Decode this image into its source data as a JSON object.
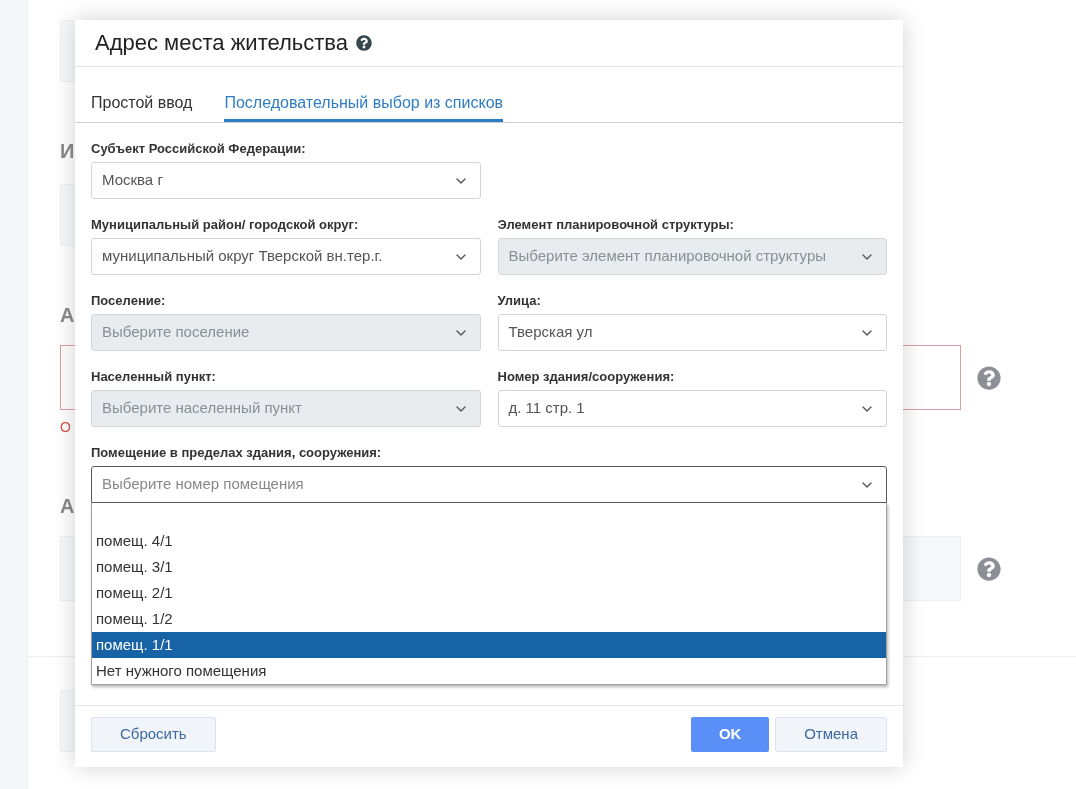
{
  "background": {
    "blocks": [
      {
        "kind": "panel"
      },
      {
        "kind": "heading",
        "text": "И"
      },
      {
        "kind": "panel"
      },
      {
        "kind": "heading",
        "text": "А"
      },
      {
        "kind": "field",
        "invalid": true
      },
      {
        "kind": "error",
        "text": "О"
      },
      {
        "kind": "heading",
        "text": "А"
      },
      {
        "kind": "field",
        "invalid": false
      },
      {
        "kind": "divider"
      },
      {
        "kind": "panel"
      }
    ]
  },
  "dialog": {
    "title": "Адрес места жительства",
    "tabs": [
      {
        "label": "Простой ввод",
        "selected": false
      },
      {
        "label": "Последовательный выбор из списков",
        "selected": true
      }
    ],
    "form": {
      "rows": [
        [
          {
            "label": "Субъект Российской Федерации:",
            "value": "Москва г",
            "disabled": false
          }
        ],
        [
          {
            "label": "Муниципальный район/ городской округ:",
            "value": "муниципальный округ Тверской вн.тер.г.",
            "disabled": false
          },
          {
            "label": "Элемент планировочной структуры:",
            "placeholder": "Выберите элемент планировочной структуры",
            "disabled": true
          }
        ],
        [
          {
            "label": "Поселение:",
            "placeholder": "Выберите поселение",
            "disabled": true
          },
          {
            "label": "Улица:",
            "value": "Тверская ул",
            "disabled": false
          }
        ],
        [
          {
            "label": "Населенный пункт:",
            "placeholder": "Выберите населенный пункт",
            "disabled": true
          },
          {
            "label": "Номер здания/сооружения:",
            "value": "д. 11 стр. 1",
            "disabled": false
          }
        ]
      ],
      "room": {
        "label": "Помещение в пределах здания, сооружения:",
        "placeholder": "Выберите номер помещения",
        "expanded": true,
        "options": [
          {
            "label": "помещ. 4/1",
            "selected": false
          },
          {
            "label": "помещ. 3/1",
            "selected": false
          },
          {
            "label": "помещ. 2/1",
            "selected": false
          },
          {
            "label": "помещ. 1/2",
            "selected": false
          },
          {
            "label": "помещ. 1/1",
            "selected": true
          },
          {
            "label": "Нет нужного помещения",
            "selected": false
          }
        ]
      }
    },
    "footer": {
      "left_buttons": [
        {
          "label": "Сбросить",
          "kind": "secondary"
        }
      ],
      "right_buttons": [
        {
          "label": "OK",
          "kind": "primary"
        },
        {
          "label": "Отмена",
          "kind": "secondary"
        }
      ]
    }
  }
}
